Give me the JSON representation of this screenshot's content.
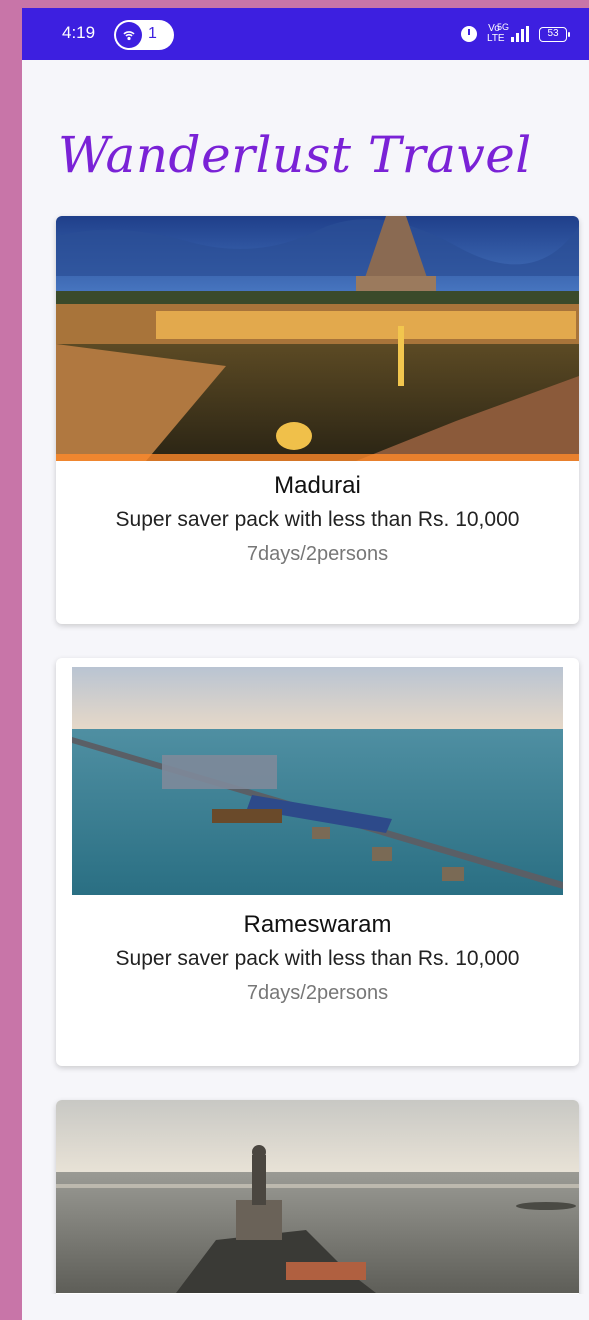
{
  "status_bar": {
    "time": "4:19",
    "hotspot_count": "1",
    "network_label": "5G",
    "volte_label": "Vo LTE",
    "battery": "53"
  },
  "app": {
    "title": "Wanderlust Travel",
    "title_color": "#7a22d6",
    "status_bar_color": "#3d1fe0"
  },
  "packages": [
    {
      "name": "Madurai",
      "description": "Super saver pack with less than Rs. 10,000",
      "duration": "7days/2persons",
      "image_icon": "temple-image"
    },
    {
      "name": "Rameswaram",
      "description": "Super saver pack with less than Rs. 10,000",
      "duration": "7days/2persons",
      "image_icon": "bridge-image"
    },
    {
      "name": "",
      "description": "",
      "duration": "",
      "image_icon": "statue-image"
    }
  ]
}
